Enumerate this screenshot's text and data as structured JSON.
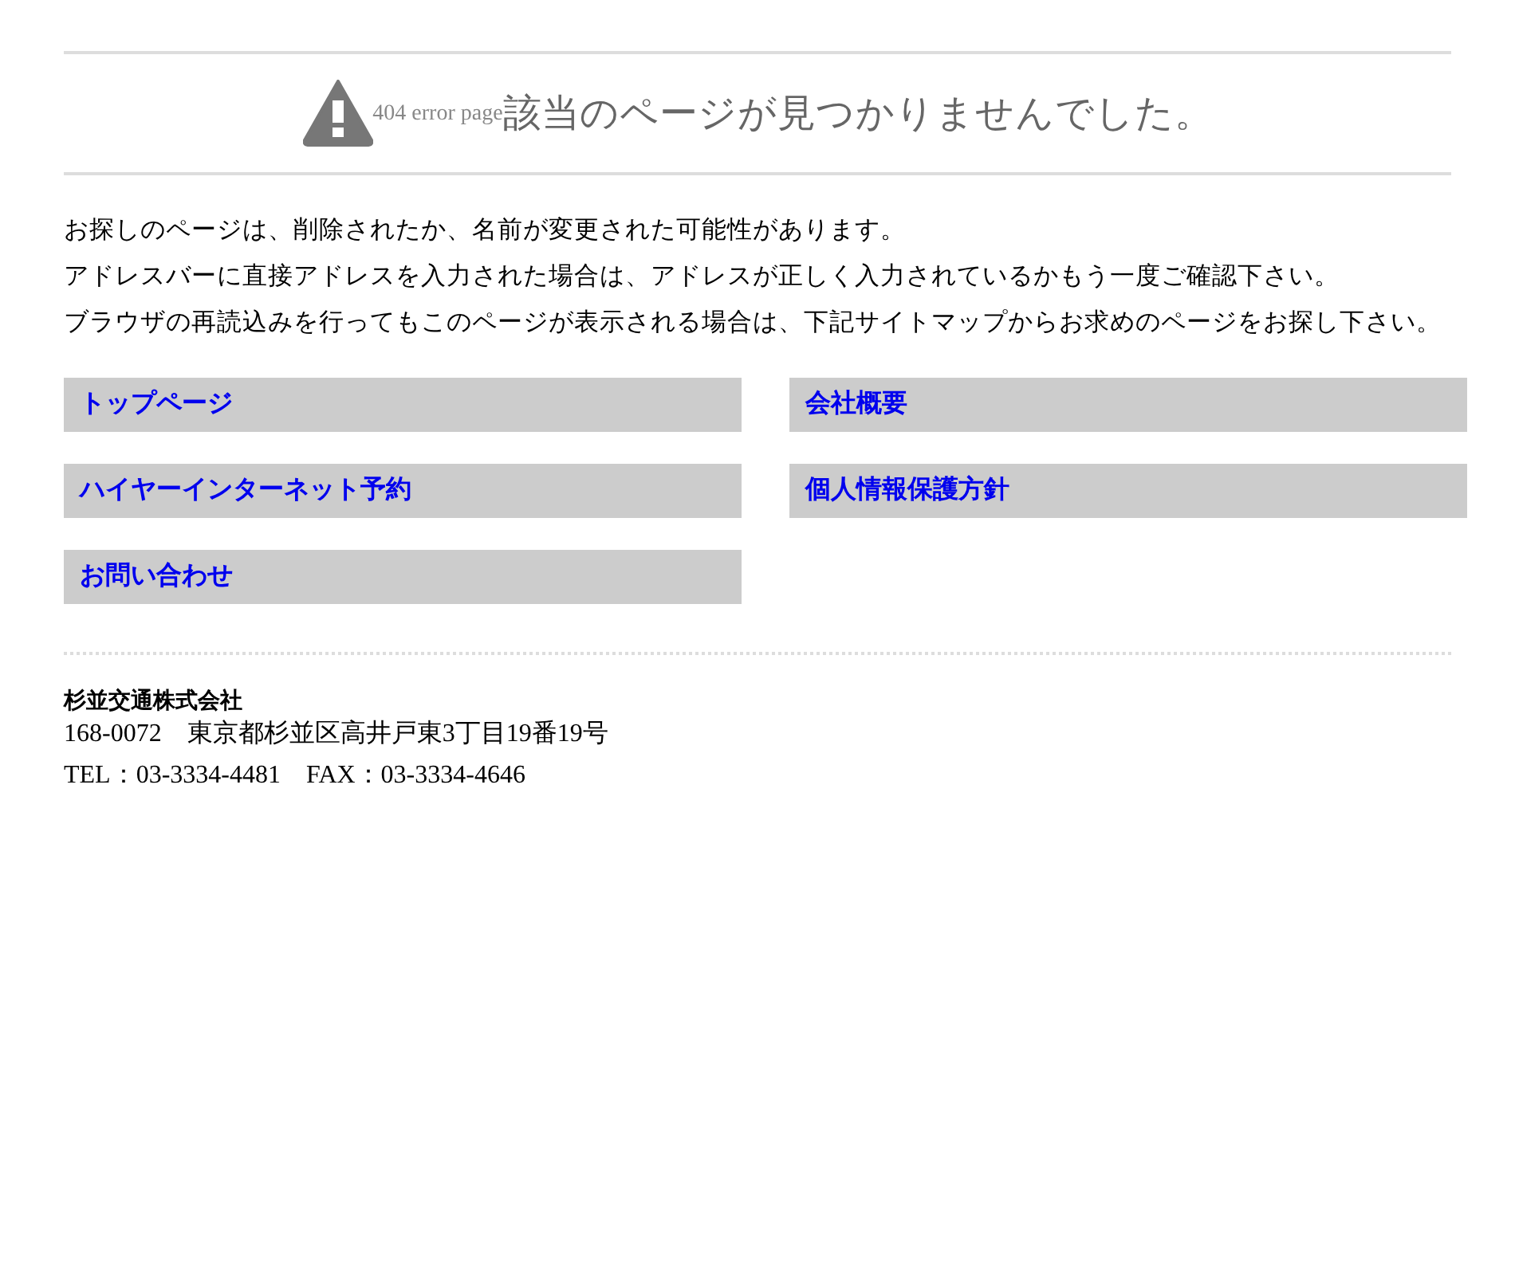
{
  "header": {
    "label": "404 error page",
    "title": "該当のページが見つかりませんでした。"
  },
  "message": [
    "お探しのページは、削除されたか、名前が変更された可能性があります。",
    "アドレスバーに直接アドレスを入力された場合は、アドレスが正しく入力されているかもう一度ご確認下さい。",
    "ブラウザの再読込みを行ってもこのページが表示される場合は、下記サイトマップからお求めのページをお探し下さい。"
  ],
  "sitemap": [
    "トップページ",
    "会社概要",
    "ハイヤーインターネット予約",
    "個人情報保護方針",
    "お問い合わせ"
  ],
  "footer": {
    "company": "杉並交通株式会社",
    "address": "168-0072　東京都杉並区高井戸東3丁目19番19号",
    "contact": "TEL：03-3334-4481　FAX：03-3334-4646"
  }
}
